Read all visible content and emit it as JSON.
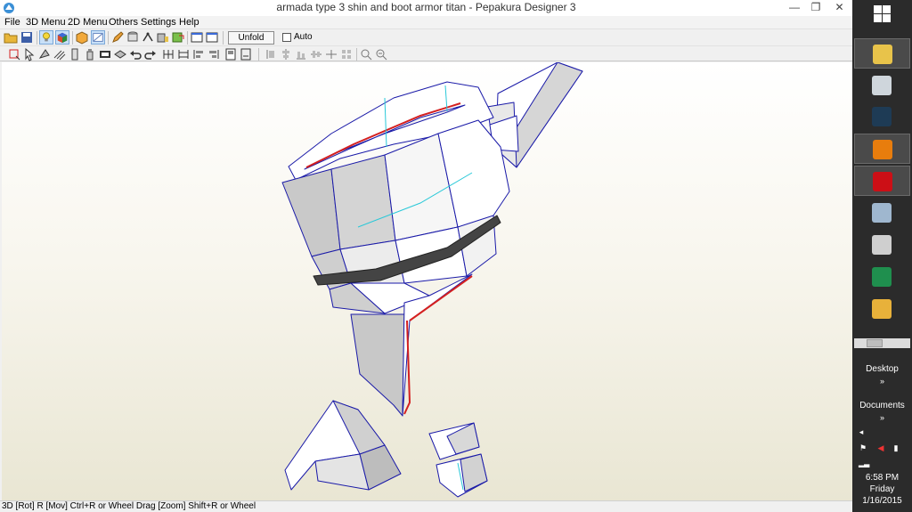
{
  "window": {
    "title": "armada type 3 shin and boot armor titan - Pepakura Designer 3",
    "minimize_glyph": "—",
    "maximize_glyph": "❐",
    "close_glyph": "✕"
  },
  "menu": {
    "items": [
      "File",
      "3D Menu",
      "2D Menu",
      "Others",
      "Settings",
      "Help"
    ]
  },
  "toolbar": {
    "unfold_label": "Unfold",
    "auto_label": "Auto",
    "auto_checked": false
  },
  "statusbar": {
    "hint": "3D [Rot] R [Mov] Ctrl+R or Wheel Drag [Zoom] Shift+R or Wheel"
  },
  "taskbar": {
    "items": [
      {
        "name": "file-explorer",
        "color": "#e8c34a",
        "active": true
      },
      {
        "name": "paint-app",
        "color": "#cfd6dc",
        "active": false
      },
      {
        "name": "media-app",
        "color": "#1e3b55",
        "active": false
      },
      {
        "name": "blender",
        "color": "#e87d0d",
        "active": true
      },
      {
        "name": "opera",
        "color": "#cc0f16",
        "active": true
      },
      {
        "name": "task-manager",
        "color": "#9fb7cf",
        "active": false
      },
      {
        "name": "printer-app",
        "color": "#cfcfcf",
        "active": false
      },
      {
        "name": "green-app",
        "color": "#1f8f4e",
        "active": false
      },
      {
        "name": "scissors-app",
        "color": "#e8b13a",
        "active": false
      }
    ],
    "desktop_label": "Desktop",
    "documents_label": "Documents",
    "chevron": "»"
  },
  "clock": {
    "time": "6:58 PM",
    "day": "Friday",
    "date": "1/16/2015"
  },
  "colors": {
    "accent_red": "#d42020",
    "edge_blue": "#1a1aa8",
    "fold_cyan": "#28c8d8"
  }
}
